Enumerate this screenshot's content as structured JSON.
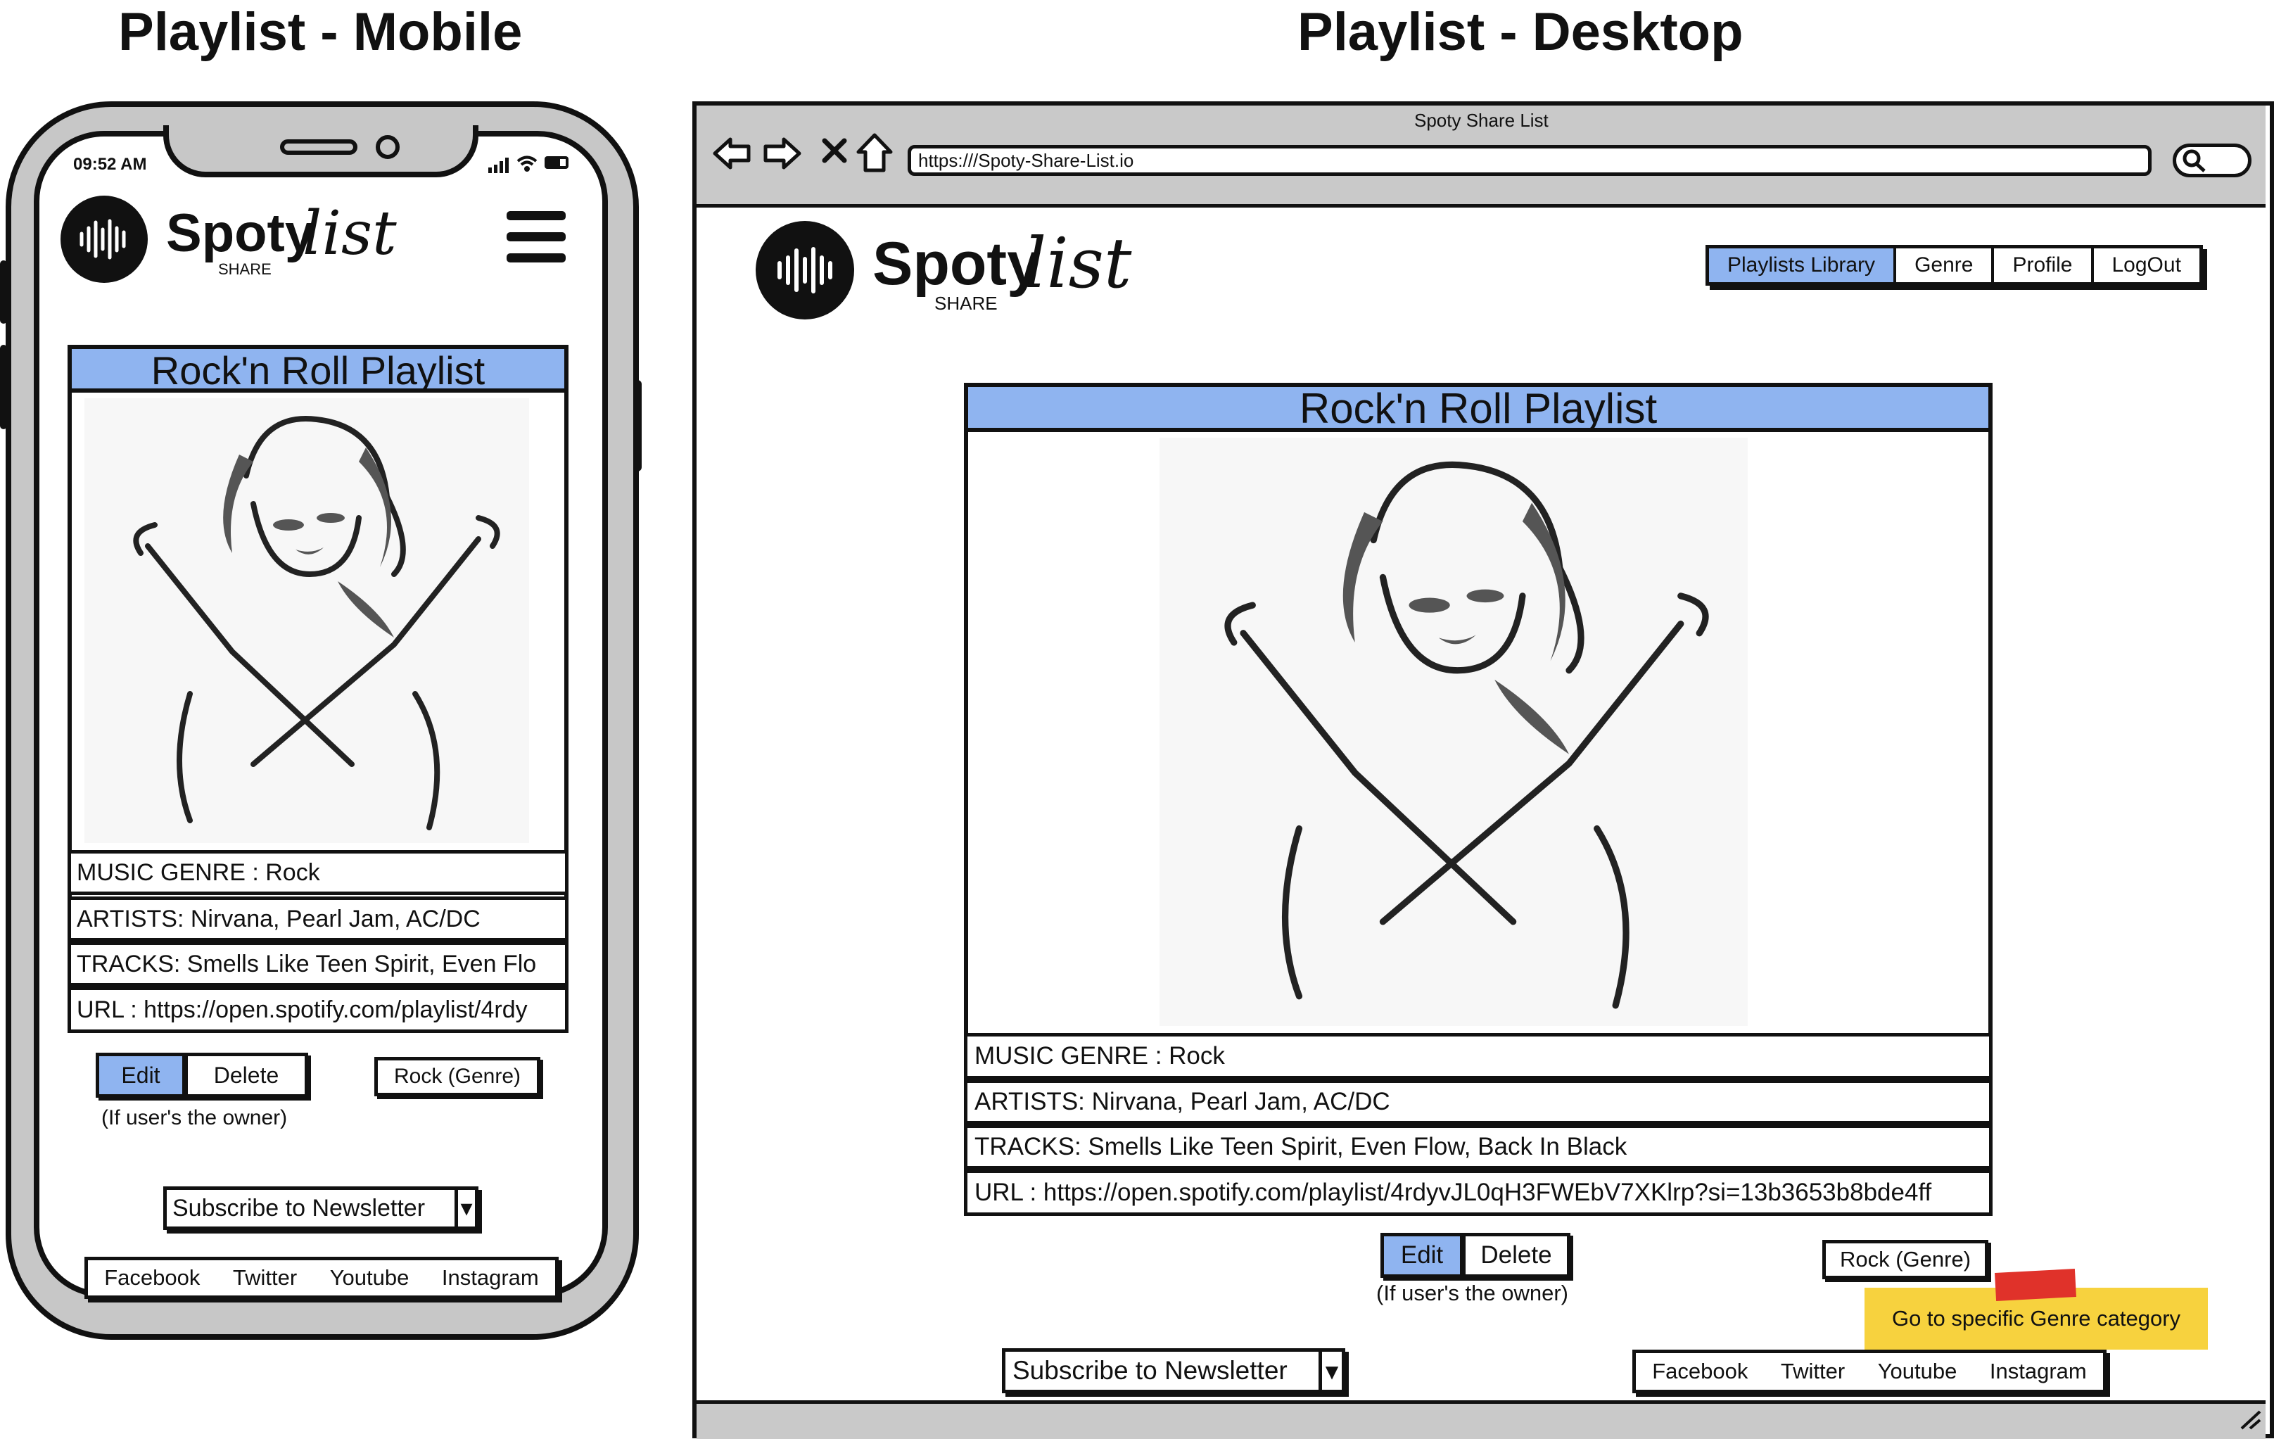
{
  "mobile": {
    "heading": "Playlist - Mobile",
    "status_time": "09:52 AM",
    "logo": {
      "word": "Spoty",
      "script": "list",
      "sub": "SHARE"
    },
    "menu_icon": "hamburger-menu-icon",
    "card": {
      "title": "Rock'n Roll Playlist",
      "genre": "MUSIC GENRE :  Rock",
      "artists": "ARTISTS: Nirvana, Pearl Jam, AC/DC",
      "tracks": "TRACKS: Smells Like Teen Spirit, Even Flo",
      "url": "URL : https://open.spotify.com/playlist/4rdy"
    },
    "buttons": {
      "edit": "Edit",
      "delete": "Delete",
      "genre": "Rock (Genre)"
    },
    "owner_note": "(If user's the owner)",
    "newsletter": "Subscribe to Newsletter",
    "social": [
      "Facebook",
      "Twitter",
      "Youtube",
      "Instagram"
    ]
  },
  "desktop": {
    "heading": "Playlist - Desktop",
    "window_title": "Spoty Share List",
    "url": "https:///Spoty-Share-List.io",
    "logo": {
      "word": "Spoty",
      "script": "list",
      "sub": "SHARE"
    },
    "nav": [
      "Playlists Library",
      "Genre",
      "Profile",
      "LogOut"
    ],
    "card": {
      "title": "Rock'n Roll Playlist",
      "genre": "MUSIC GENRE :  Rock",
      "artists": "ARTISTS: Nirvana, Pearl Jam, AC/DC",
      "tracks": "TRACKS: Smells Like Teen Spirit, Even Flow, Back In Black",
      "url": "URL : https://open.spotify.com/playlist/4rdyvJL0qH3FWEbV7XKlrp?si=13b3653b8bde4ff"
    },
    "buttons": {
      "edit": "Edit",
      "delete": "Delete",
      "genre": "Rock (Genre)"
    },
    "owner_note": "(If user's the owner)",
    "sticky_note": "Go to specific Genre category",
    "newsletter": "Subscribe to Newsletter",
    "social": [
      "Facebook",
      "Twitter",
      "Youtube",
      "Instagram"
    ]
  },
  "colors": {
    "accent": "#8fb4f0",
    "chrome": "#c9c9c9",
    "sticky": "#f7d23e",
    "tape": "#e0322a"
  }
}
